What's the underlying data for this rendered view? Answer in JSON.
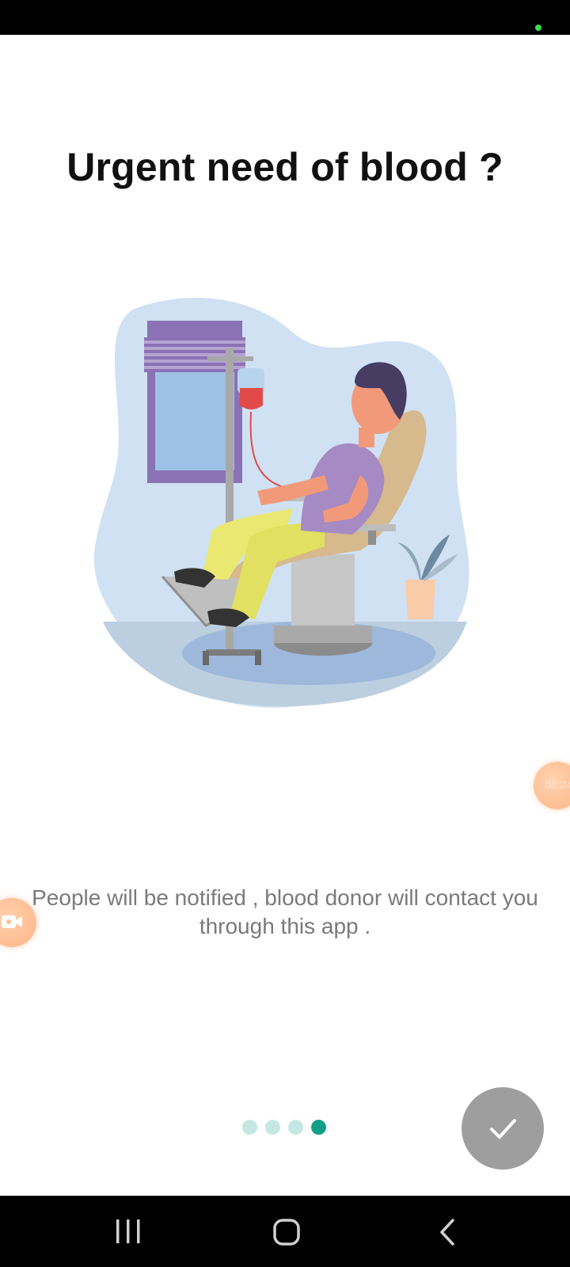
{
  "onboarding": {
    "title": "Urgent need of blood ?",
    "description": "People will be notified , blood donor will contact you through this app .",
    "page_count": 4,
    "current_page": 4,
    "done_icon": "check-icon"
  },
  "overlay": {
    "recorder_timer": "00:24",
    "recorder_icon": "video-camera-icon"
  },
  "system_nav": {
    "recents_icon": "recent-apps-icon",
    "home_icon": "home-icon",
    "back_icon": "back-icon"
  },
  "colors": {
    "accent_active_dot": "#129e87",
    "inactive_dot": "#c4e8e1",
    "done_button": "#9e9e9e"
  }
}
